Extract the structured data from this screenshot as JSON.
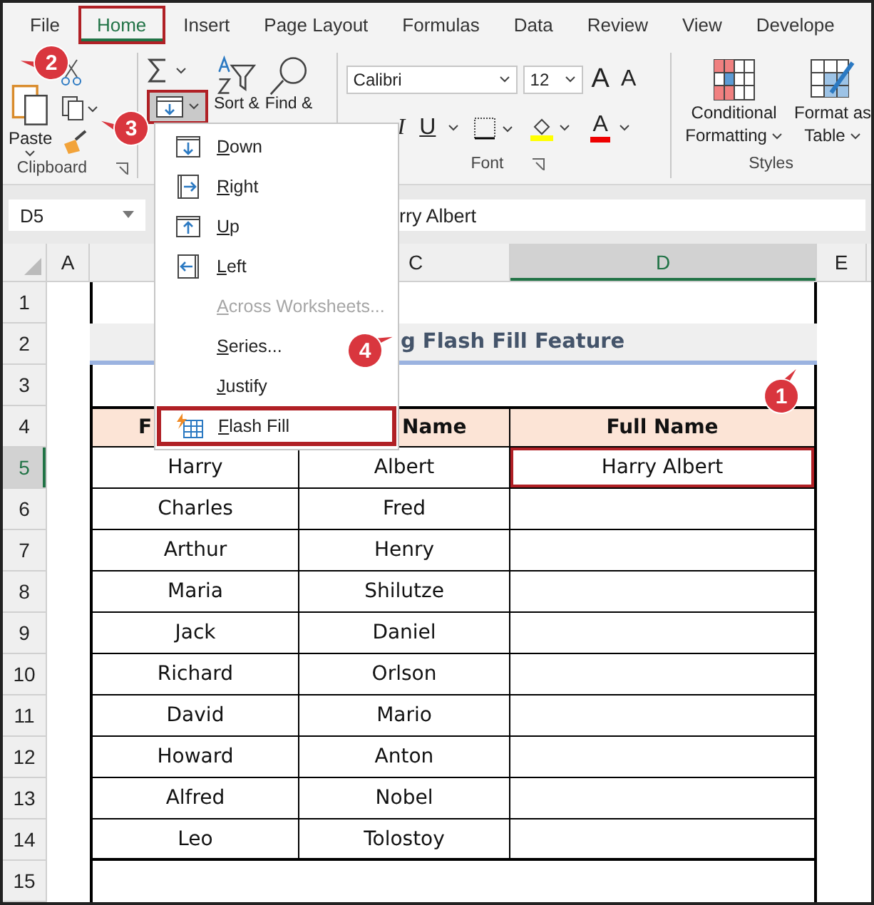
{
  "ribbon_tabs": [
    {
      "label": "File",
      "selected": false,
      "marked": false
    },
    {
      "label": "Home",
      "selected": true,
      "marked": true
    },
    {
      "label": "Insert",
      "selected": false,
      "marked": false
    },
    {
      "label": "Page Layout",
      "selected": false,
      "marked": false
    },
    {
      "label": "Formulas",
      "selected": false,
      "marked": false
    },
    {
      "label": "Data",
      "selected": false,
      "marked": false
    },
    {
      "label": "Review",
      "selected": false,
      "marked": false
    },
    {
      "label": "View",
      "selected": false,
      "marked": false
    },
    {
      "label": "Develope",
      "selected": false,
      "marked": false
    }
  ],
  "clipboard": {
    "paste": "Paste",
    "label": "Clipboard"
  },
  "editing": {
    "fill_marked": true,
    "sort": "Sort &",
    "find": "Find &"
  },
  "font": {
    "name": "Calibri",
    "size": "12",
    "grow": "A",
    "shrink": "A",
    "italic": "I",
    "underline": "U",
    "color_button": "A",
    "label": "Font"
  },
  "styles": {
    "conditional": [
      "Conditional",
      "Formatting"
    ],
    "table": [
      "Format as",
      "Table"
    ],
    "label": "Styles"
  },
  "formula_bar": {
    "name_box": "D5",
    "value": "rry Albert"
  },
  "column_headers": [
    {
      "label": "A",
      "selected": false
    },
    {
      "label": "C",
      "selected": false
    },
    {
      "label": "D",
      "selected": true
    },
    {
      "label": "E",
      "selected": false
    }
  ],
  "row_headers": [
    {
      "label": "1",
      "selected": false
    },
    {
      "label": "2",
      "selected": false
    },
    {
      "label": "3",
      "selected": false
    },
    {
      "label": "4",
      "selected": false
    },
    {
      "label": "5",
      "selected": true
    },
    {
      "label": "6",
      "selected": false
    },
    {
      "label": "7",
      "selected": false
    },
    {
      "label": "8",
      "selected": false
    },
    {
      "label": "9",
      "selected": false
    },
    {
      "label": "10",
      "selected": false
    },
    {
      "label": "11",
      "selected": false
    },
    {
      "label": "12",
      "selected": false
    },
    {
      "label": "13",
      "selected": false
    },
    {
      "label": "14",
      "selected": false
    },
    {
      "label": "15",
      "selected": false
    }
  ],
  "title": "g Flash Fill Feature",
  "table": {
    "columns": [
      "F",
      "Name",
      "Full Name"
    ],
    "rows": [
      [
        "Harry",
        "Albert",
        "Harry Albert"
      ],
      [
        "Charles",
        "Fred",
        ""
      ],
      [
        "Arthur",
        "Henry",
        ""
      ],
      [
        "Maria",
        "Shilutze",
        ""
      ],
      [
        "Jack",
        "Daniel",
        ""
      ],
      [
        "Richard",
        "Orlson",
        ""
      ],
      [
        "David",
        "Mario",
        ""
      ],
      [
        "Howard",
        "Anton",
        ""
      ],
      [
        "Alfred",
        "Nobel",
        ""
      ],
      [
        "Leo",
        "Tolostoy",
        ""
      ]
    ]
  },
  "fill_menu": [
    {
      "label": "Down",
      "kind": "down",
      "disabled": false,
      "marked": false
    },
    {
      "label": "Right",
      "kind": "right",
      "disabled": false,
      "marked": false
    },
    {
      "label": "Up",
      "kind": "up",
      "disabled": false,
      "marked": false
    },
    {
      "label": "Left",
      "kind": "left",
      "disabled": false,
      "marked": false
    },
    {
      "label": "Across Worksheets...",
      "kind": "plain",
      "disabled": true,
      "marked": false
    },
    {
      "label": "Series...",
      "kind": "plain",
      "disabled": false,
      "marked": false
    },
    {
      "label": "Justify",
      "kind": "plain",
      "disabled": false,
      "marked": false
    },
    {
      "label": "Flash Fill",
      "kind": "flash",
      "disabled": false,
      "marked": true
    }
  ],
  "callouts": [
    "2",
    "3",
    "4",
    "1"
  ]
}
